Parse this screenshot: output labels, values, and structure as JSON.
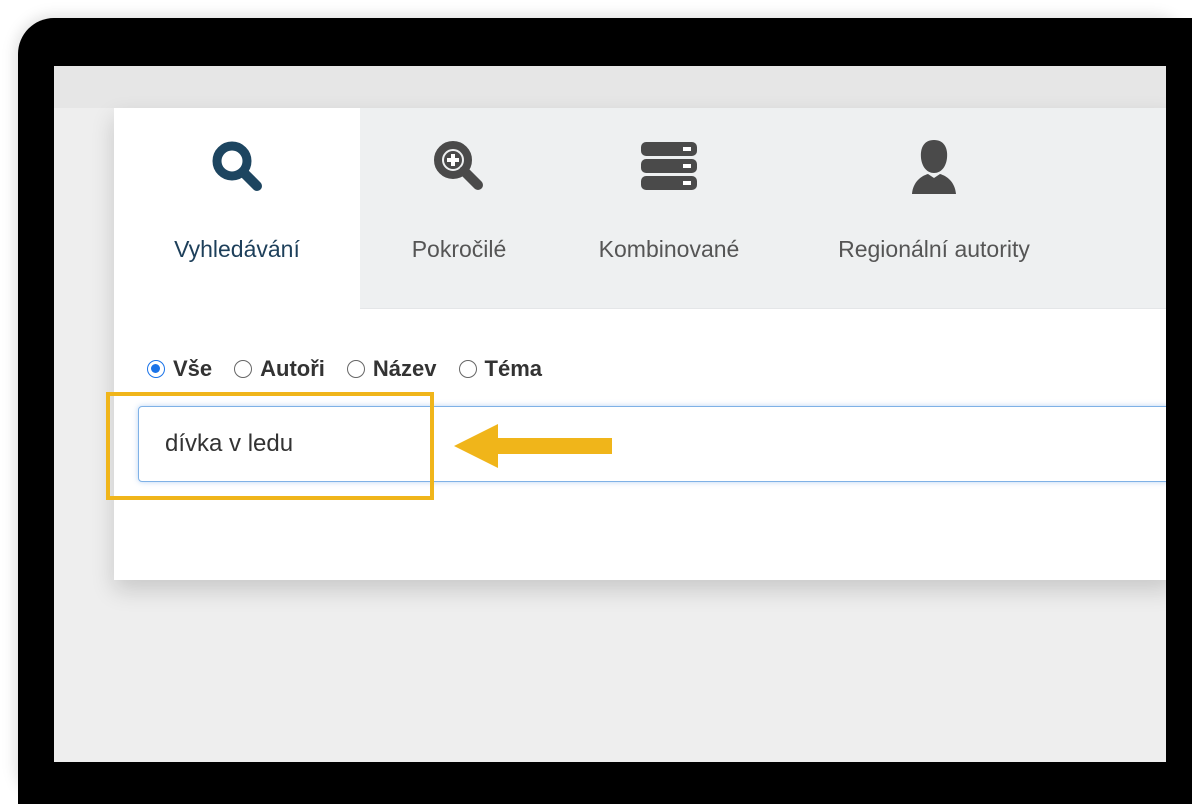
{
  "tabs": [
    {
      "label": "Vyhledávání",
      "icon": "search-icon",
      "active": true
    },
    {
      "label": "Pokročilé",
      "icon": "zoom-in-icon",
      "active": false
    },
    {
      "label": "Kombinované",
      "icon": "server-stack-icon",
      "active": false
    },
    {
      "label": "Regionální autority",
      "icon": "user-icon",
      "active": false
    }
  ],
  "search": {
    "scopes": [
      {
        "label": "Vše",
        "checked": true
      },
      {
        "label": "Autoři",
        "checked": false
      },
      {
        "label": "Název",
        "checked": false
      },
      {
        "label": "Téma",
        "checked": false
      }
    ],
    "value": "dívka v ledu",
    "placeholder": ""
  },
  "annotation": {
    "color": "#f0b51a"
  },
  "colors": {
    "active_icon": "#1d4560",
    "inactive_icon": "#4a4a4a",
    "radio_accent": "#1a73e8",
    "focus_border": "#7fb1e6"
  }
}
